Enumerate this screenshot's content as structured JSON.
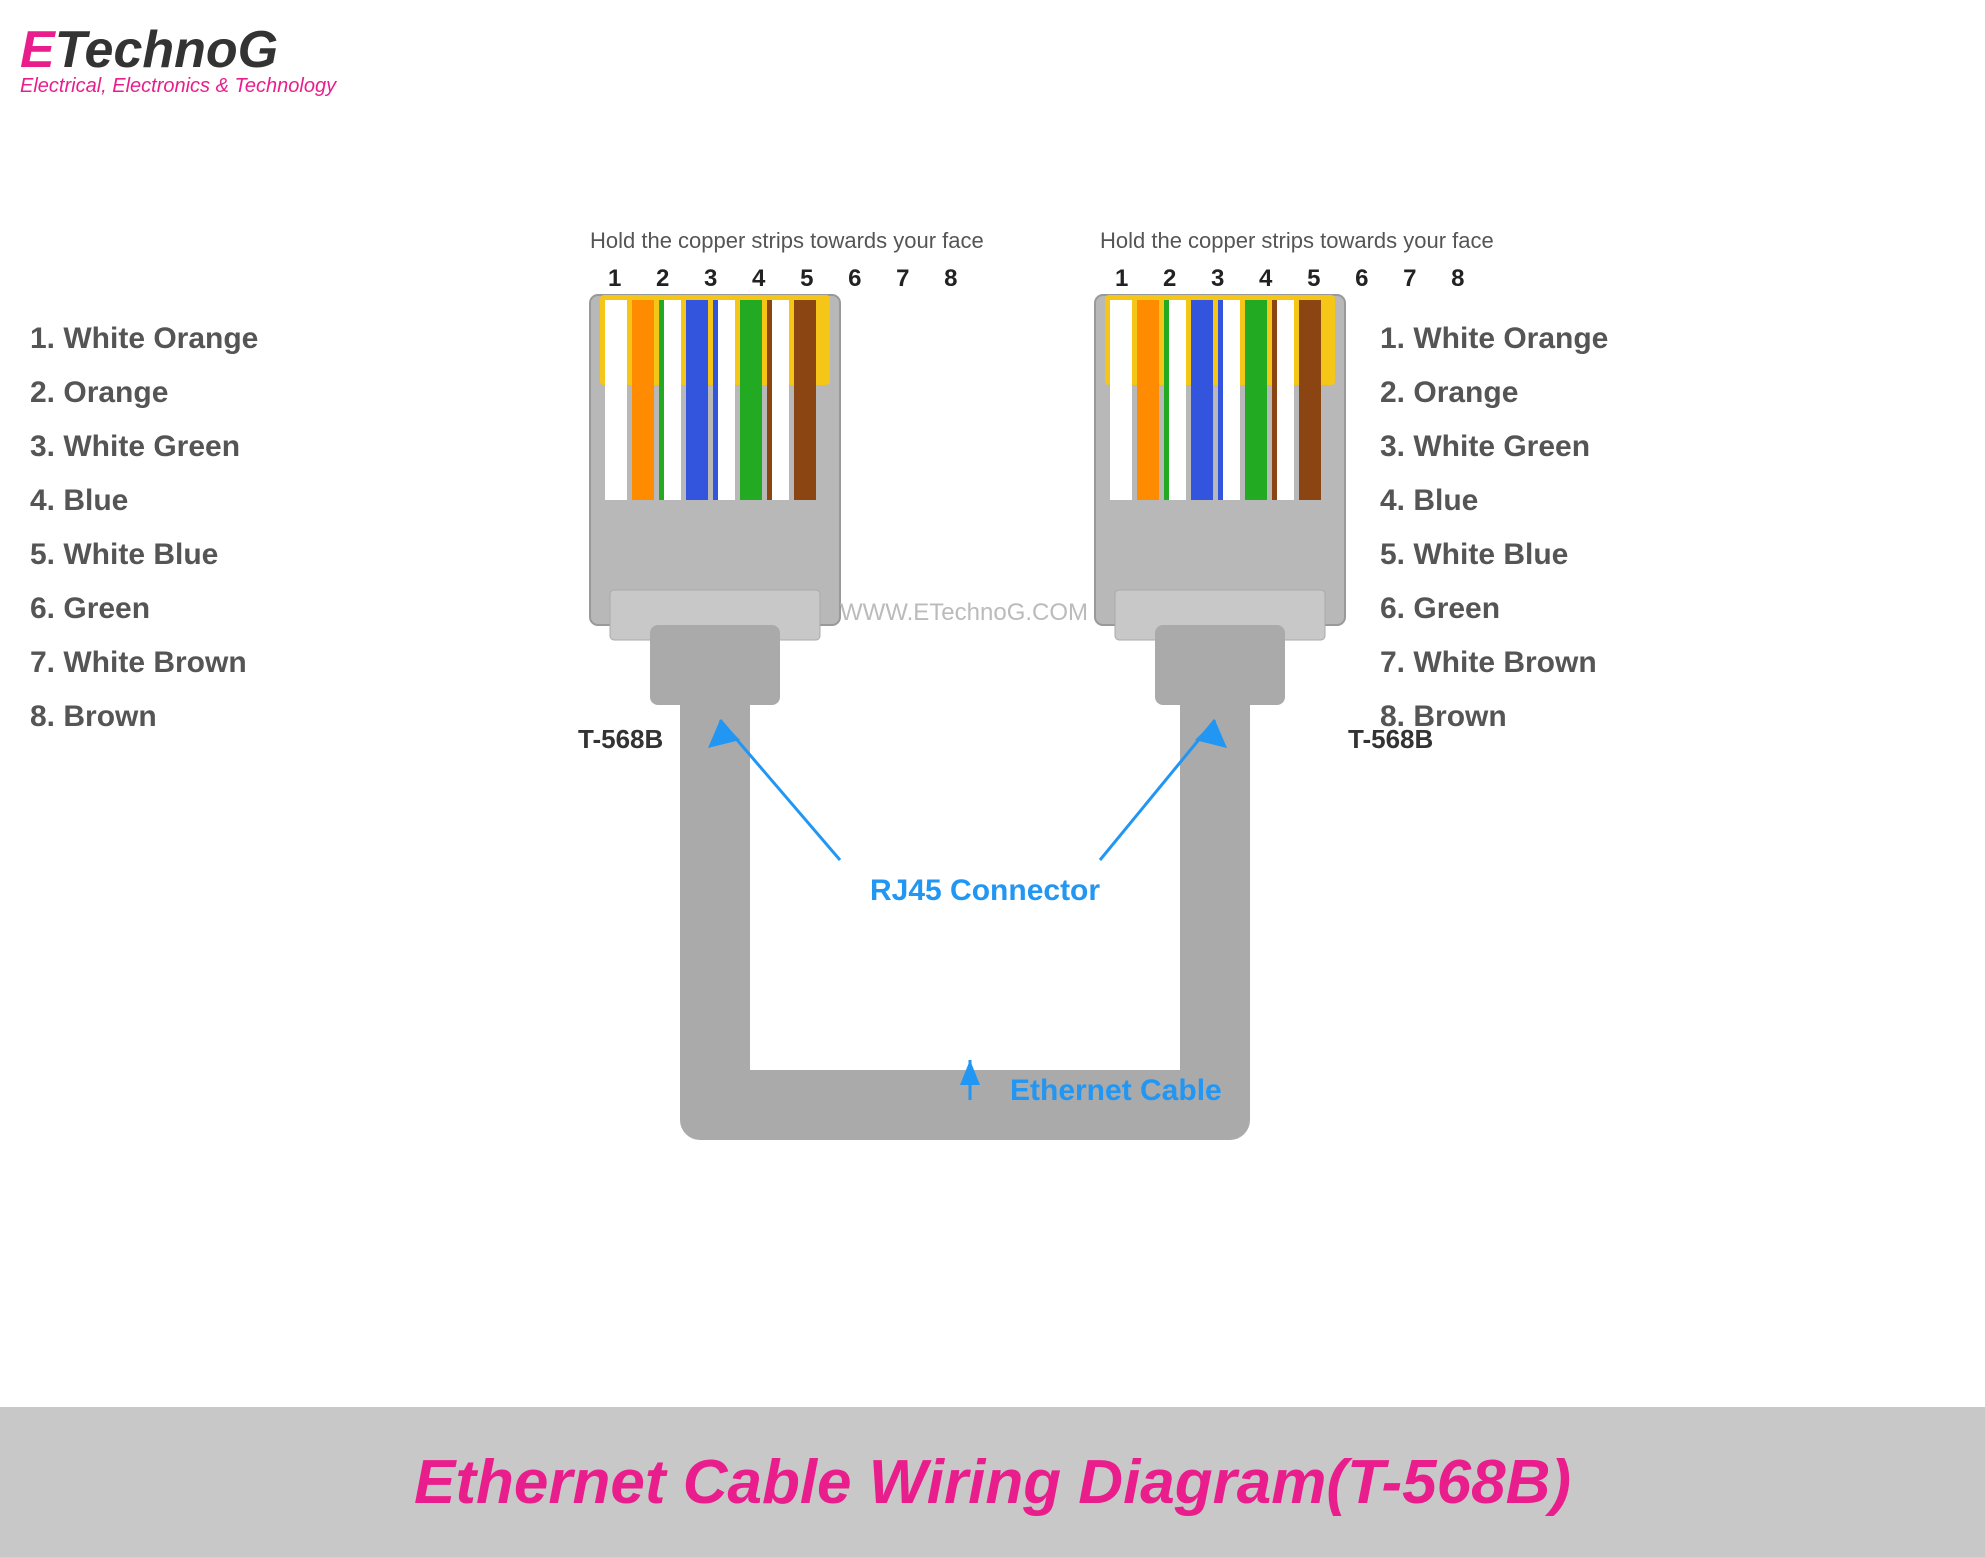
{
  "logo": {
    "e": "E",
    "technog": "TechnoG",
    "subtitle": "Electrical, Electronics & Technology"
  },
  "left_connector": {
    "instruction": "Hold the copper strips towards your face",
    "pin_numbers": "1 2 3 4 5 6 7 8",
    "label": "T-568B"
  },
  "right_connector": {
    "instruction": "Hold the copper strips towards your face",
    "pin_numbers": "1 2 3 4 5 6 7 8",
    "label": "T-568B"
  },
  "wire_labels": [
    "1. White Orange",
    "2. Orange",
    "3. White Green",
    "4. Blue",
    "5. White Blue",
    "6. Green",
    "7. White Brown",
    "8. Brown"
  ],
  "watermark": "WWW.ETechnoG.COM",
  "rj45_label": "RJ45 Connector",
  "ethernet_label": "Ethernet Cable",
  "footer_title": "Ethernet Cable Wiring Diagram(T-568B)"
}
